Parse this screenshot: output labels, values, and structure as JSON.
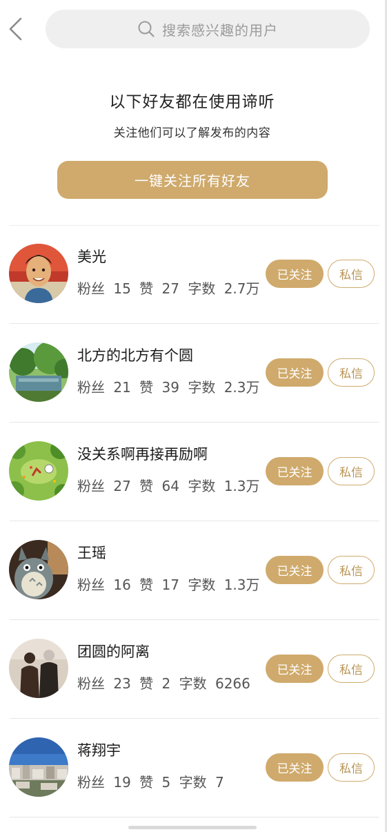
{
  "header": {
    "search_placeholder": "搜索感兴趣的用户",
    "back_icon": "chevron-left-icon",
    "search_icon": "search-icon"
  },
  "intro": {
    "title": "以下好友都在使用谛听",
    "subtitle": "关注他们可以了解发布的内容",
    "follow_all_label": "一键关注所有好友"
  },
  "labels": {
    "fans": "粉丝",
    "likes": "赞",
    "words": "字数",
    "followed_button": "已关注",
    "message_button": "私信"
  },
  "users": [
    {
      "name": "美光",
      "fans": "15",
      "likes": "27",
      "words": "2.7万"
    },
    {
      "name": "北方的北方有个圆",
      "fans": "21",
      "likes": "39",
      "words": "2.3万"
    },
    {
      "name": "没关系啊再接再励啊",
      "fans": "27",
      "likes": "64",
      "words": "1.3万"
    },
    {
      "name": "王瑶",
      "fans": "16",
      "likes": "17",
      "words": "1.3万"
    },
    {
      "name": "团圆的阿离",
      "fans": "23",
      "likes": "2",
      "words": "6266"
    },
    {
      "name": "蒋翔宇",
      "fans": "19",
      "likes": "5",
      "words": "7"
    }
  ],
  "colors": {
    "accent": "#cfaa6c",
    "search_bg": "#efefef",
    "divider": "#e6e6e6"
  }
}
